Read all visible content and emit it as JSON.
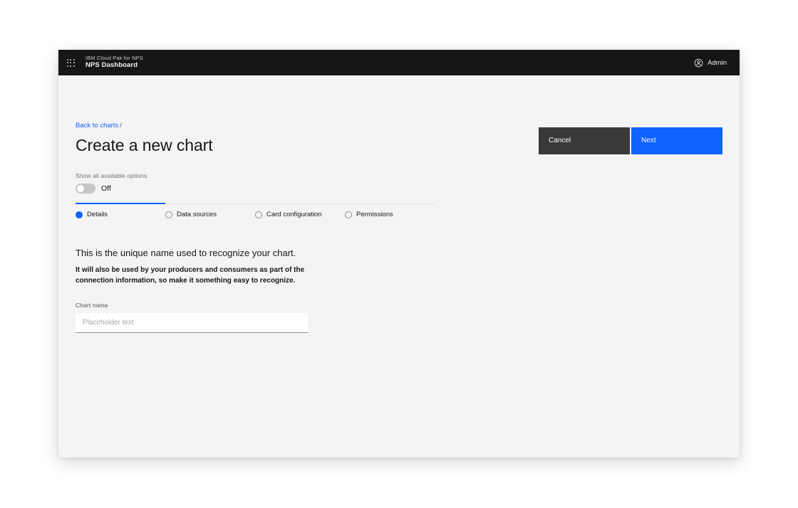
{
  "header": {
    "app_switcher_icon": "grid-dots-icon",
    "product_prefix": "IBM Cloud Pak for NPS",
    "product_name": "NPS Dashboard",
    "user_icon": "user-avatar-icon",
    "user_label": "Admin"
  },
  "breadcrumb": {
    "link_label": "Back to charts",
    "separator": "/"
  },
  "page": {
    "title": "Create a new chart"
  },
  "toggle": {
    "caption": "Show all available options",
    "state_label": "Off",
    "checked": false
  },
  "progress": {
    "steps": [
      {
        "label": "Details",
        "active": true
      },
      {
        "label": "Data sources",
        "active": false
      },
      {
        "label": "Card configuration",
        "active": false
      },
      {
        "label": "Permissions",
        "active": false
      }
    ]
  },
  "copy": {
    "lead": "This is the unique name used to recognize your chart.",
    "detail": "It will also be used by your producers and consumers as part of the connection information, so make it something easy to recognize."
  },
  "form": {
    "chart_name_label": "Chart name",
    "chart_name_value": "",
    "chart_name_placeholder": "Placeholder text"
  },
  "actions": {
    "cancel_label": "Cancel",
    "next_label": "Next"
  },
  "colors": {
    "accent_blue": "#0f62fe",
    "header_black": "#161616",
    "secondary_gray": "#393939",
    "page_background": "#f4f4f4"
  }
}
